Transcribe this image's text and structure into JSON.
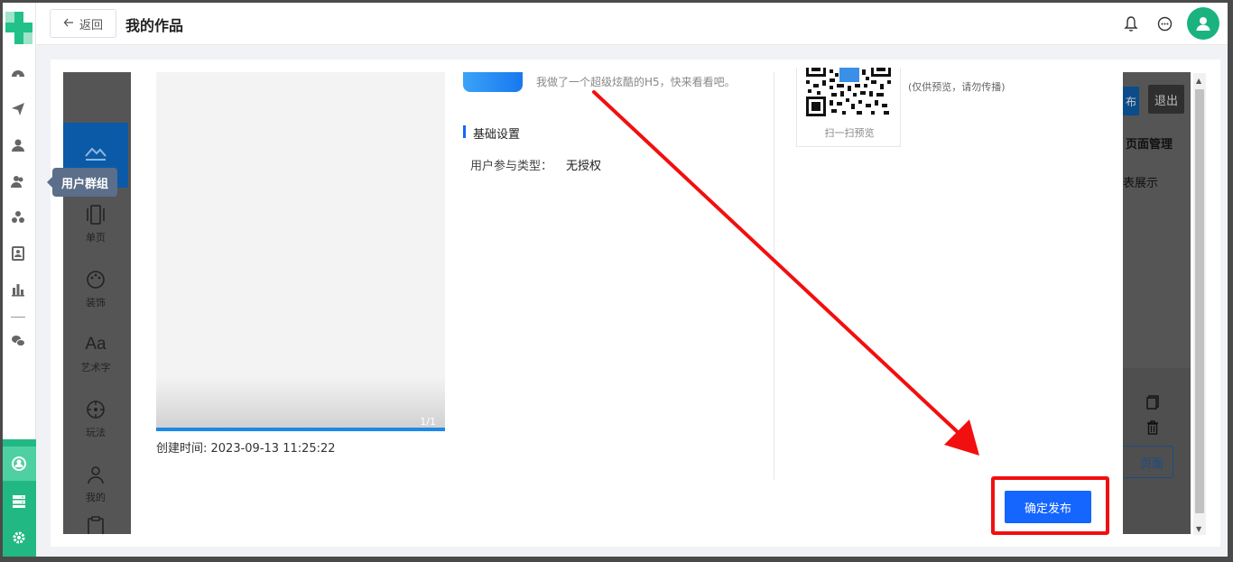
{
  "header": {
    "back_label": "返回",
    "title": "我的作品"
  },
  "rail": {
    "icons": [
      "dashboard-icon",
      "send-icon",
      "user-icon",
      "user-group-icon",
      "cluster-icon",
      "badge-icon",
      "bar-chart-icon",
      "wechat-icon"
    ],
    "bottom_icons": [
      "team-icon",
      "server-icon",
      "settings-icon"
    ]
  },
  "tooltip": "用户群组",
  "editor_sidebar": {
    "items": [
      {
        "label": "单页",
        "icon": "page-icon"
      },
      {
        "label": "装饰",
        "icon": "palette-icon"
      },
      {
        "label": "艺术字",
        "icon": "text-aa-icon"
      },
      {
        "label": "玩法",
        "icon": "game-icon"
      },
      {
        "label": "我的",
        "icon": "person-icon"
      }
    ]
  },
  "editor_right": {
    "publish_partial": "布",
    "exit": "退出",
    "page_manage": "页面管理",
    "list_show": "表展示",
    "add_page": "页面"
  },
  "preview": {
    "page_indicator": "1/1",
    "created": "创建时间: 2023-09-13 11:25:22"
  },
  "info": {
    "description": "我做了一个超级炫酷的H5，快来看看吧。",
    "section_title": "基础设置",
    "field_label": "用户参与类型：",
    "field_value": "无授权"
  },
  "qr": {
    "caption": "扫一扫预览",
    "note": "(仅供预览，请勿传播)"
  },
  "confirm_label": "确定发布",
  "colors": {
    "accent": "#1565ff",
    "brand_green": "#22b884",
    "highlight_red": "#f20f0f"
  }
}
